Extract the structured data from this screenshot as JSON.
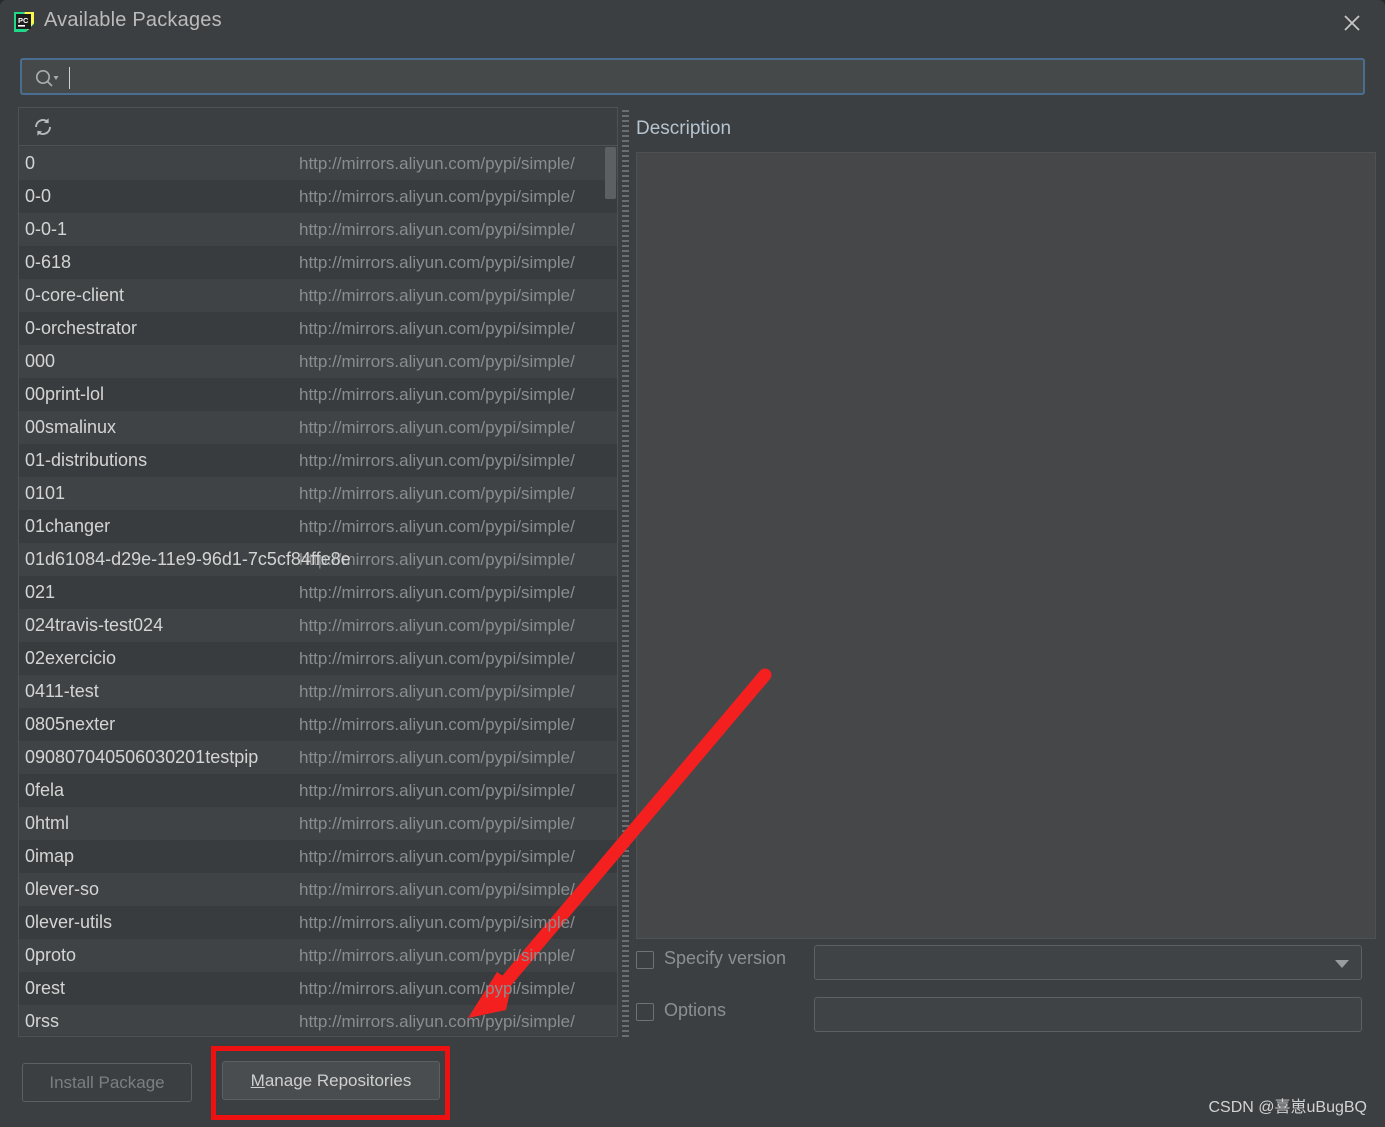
{
  "window": {
    "title": "Available Packages",
    "app_icon": "pycharm-icon",
    "close_label": "✕"
  },
  "search": {
    "icon": "search-icon",
    "value": "",
    "placeholder": ""
  },
  "list_toolbar": {
    "refresh_icon": "refresh-icon"
  },
  "repository_url": "http://mirrors.aliyun.com/pypi/simple/",
  "packages": [
    {
      "name": "0",
      "url": "http://mirrors.aliyun.com/pypi/simple/"
    },
    {
      "name": "0-0",
      "url": "http://mirrors.aliyun.com/pypi/simple/"
    },
    {
      "name": "0-0-1",
      "url": "http://mirrors.aliyun.com/pypi/simple/"
    },
    {
      "name": "0-618",
      "url": "http://mirrors.aliyun.com/pypi/simple/"
    },
    {
      "name": "0-core-client",
      "url": "http://mirrors.aliyun.com/pypi/simple/"
    },
    {
      "name": "0-orchestrator",
      "url": "http://mirrors.aliyun.com/pypi/simple/"
    },
    {
      "name": "000",
      "url": "http://mirrors.aliyun.com/pypi/simple/"
    },
    {
      "name": "00print-lol",
      "url": "http://mirrors.aliyun.com/pypi/simple/"
    },
    {
      "name": "00smalinux",
      "url": "http://mirrors.aliyun.com/pypi/simple/"
    },
    {
      "name": "01-distributions",
      "url": "http://mirrors.aliyun.com/pypi/simple/"
    },
    {
      "name": "0101",
      "url": "http://mirrors.aliyun.com/pypi/simple/"
    },
    {
      "name": "01changer",
      "url": "http://mirrors.aliyun.com/pypi/simple/"
    },
    {
      "name": "01d61084-d29e-11e9-96d1-7c5cf84ffe8e",
      "url": "http://mirrors.aliyun.com/pypi/simple/"
    },
    {
      "name": "021",
      "url": "http://mirrors.aliyun.com/pypi/simple/"
    },
    {
      "name": "024travis-test024",
      "url": "http://mirrors.aliyun.com/pypi/simple/"
    },
    {
      "name": "02exercicio",
      "url": "http://mirrors.aliyun.com/pypi/simple/"
    },
    {
      "name": "0411-test",
      "url": "http://mirrors.aliyun.com/pypi/simple/"
    },
    {
      "name": "0805nexter",
      "url": "http://mirrors.aliyun.com/pypi/simple/"
    },
    {
      "name": "090807040506030201testpip",
      "url": "http://mirrors.aliyun.com/pypi/simple/"
    },
    {
      "name": "0fela",
      "url": "http://mirrors.aliyun.com/pypi/simple/"
    },
    {
      "name": "0html",
      "url": "http://mirrors.aliyun.com/pypi/simple/"
    },
    {
      "name": "0imap",
      "url": "http://mirrors.aliyun.com/pypi/simple/"
    },
    {
      "name": "0lever-so",
      "url": "http://mirrors.aliyun.com/pypi/simple/"
    },
    {
      "name": "0lever-utils",
      "url": "http://mirrors.aliyun.com/pypi/simple/"
    },
    {
      "name": "0proto",
      "url": "http://mirrors.aliyun.com/pypi/simple/"
    },
    {
      "name": "0rest",
      "url": "http://mirrors.aliyun.com/pypi/simple/"
    },
    {
      "name": "0rss",
      "url": "http://mirrors.aliyun.com/pypi/simple/"
    }
  ],
  "description": {
    "title": "Description",
    "body": ""
  },
  "options": {
    "specify_version_label": "Specify version",
    "specify_version_checked": false,
    "version_value": "",
    "options_label": "Options",
    "options_checked": false,
    "options_value": ""
  },
  "buttons": {
    "install_label": "Install Package",
    "install_disabled": true,
    "manage_mnemonic": "M",
    "manage_rest": "anage Repositories"
  },
  "annotation": {
    "highlight_color": "#ee1111",
    "arrow_color": "#f42020"
  },
  "watermark": "CSDN @喜崽uBugBQ"
}
